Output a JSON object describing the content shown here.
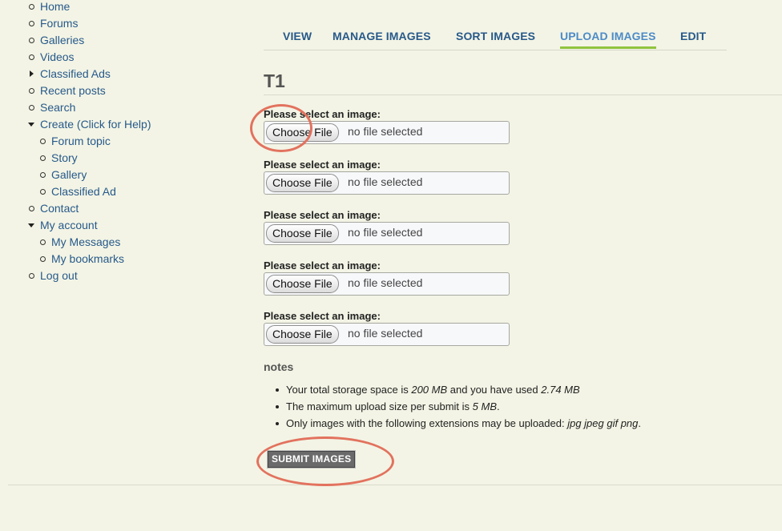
{
  "nav": {
    "items": [
      {
        "label": "Home",
        "marker": "bullet"
      },
      {
        "label": "Forums",
        "marker": "bullet"
      },
      {
        "label": "Galleries",
        "marker": "bullet"
      },
      {
        "label": "Videos",
        "marker": "bullet"
      },
      {
        "label": "Classified Ads",
        "marker": "collapsed"
      },
      {
        "label": "Recent posts",
        "marker": "bullet"
      },
      {
        "label": "Search",
        "marker": "bullet"
      },
      {
        "label": "Create (Click for Help)",
        "marker": "expanded"
      },
      {
        "label": "Forum topic",
        "marker": "bullet"
      },
      {
        "label": "Story",
        "marker": "bullet"
      },
      {
        "label": "Gallery",
        "marker": "bullet"
      },
      {
        "label": "Classified Ad",
        "marker": "bullet"
      },
      {
        "label": "Contact",
        "marker": "bullet"
      },
      {
        "label": "My account",
        "marker": "expanded"
      },
      {
        "label": "My Messages",
        "marker": "bullet"
      },
      {
        "label": "My bookmarks",
        "marker": "bullet"
      },
      {
        "label": "Log out",
        "marker": "bullet"
      }
    ]
  },
  "tabs": [
    {
      "label": "VIEW"
    },
    {
      "label": "MANAGE IMAGES"
    },
    {
      "label": "SORT IMAGES"
    },
    {
      "label": "UPLOAD IMAGES",
      "active": true
    },
    {
      "label": "EDIT"
    }
  ],
  "page_title": "T1",
  "upload": {
    "fields": [
      {
        "label": "Please select an image:",
        "button": "Choose File",
        "status": "no file selected"
      },
      {
        "label": "Please select an image:",
        "button": "Choose File",
        "status": "no file selected"
      },
      {
        "label": "Please select an image:",
        "button": "Choose File",
        "status": "no file selected"
      },
      {
        "label": "Please select an image:",
        "button": "Choose File",
        "status": "no file selected"
      },
      {
        "label": "Please select an image:",
        "button": "Choose File",
        "status": "no file selected"
      }
    ]
  },
  "notes": {
    "heading": "notes",
    "storage": {
      "pre": "Your total storage space is ",
      "total": "200 MB",
      "mid": " and you have used ",
      "used": "2.74 MB"
    },
    "max_upload": {
      "pre": "The maximum upload size per submit is ",
      "size": "5 MB",
      "post": "."
    },
    "extensions": {
      "pre": "Only images with the following extensions may be uploaded: ",
      "list": "jpg jpeg gif png",
      "post": "."
    }
  },
  "submit_label": "SUBMIT IMAGES",
  "colors": {
    "background": "#f3f4e5",
    "link": "#27598a",
    "active_tab": "#4c8bc8",
    "active_underline": "#8fc43e",
    "annotation": "#e2725e"
  }
}
